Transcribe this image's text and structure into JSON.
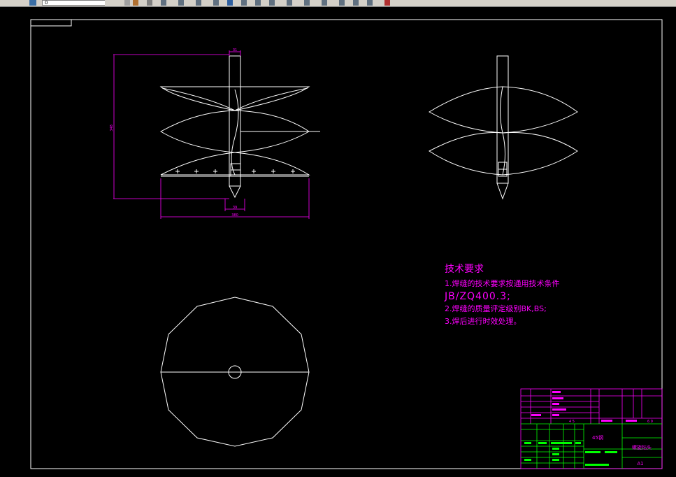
{
  "app": {
    "toolbar": {
      "layer_value": "0",
      "icons": [
        "save-icon",
        "brush-icon",
        "undo-icon",
        "layer-icon",
        "properties-icon",
        "copy-icon",
        "mirror-icon",
        "offset-icon",
        "array-icon",
        "move-icon",
        "rotate-icon",
        "scale-icon",
        "stretch-icon",
        "trim-icon",
        "extend-icon",
        "break-icon",
        "chamfer-icon",
        "fillet-icon",
        "explode-icon"
      ]
    }
  },
  "drawing": {
    "dimensions": {
      "shaft_width_top": "31",
      "height_left": "348",
      "tip_width_bottom": "39",
      "overall_width": "380"
    },
    "notes": {
      "title": "技术要求",
      "lines": [
        "1.焊缝的技术要求按通用技术条件",
        "JB/ZQ400.3;",
        "2.焊缝的质量评定级别BK,BS;",
        "3.焊后进行时效处理。"
      ]
    },
    "title_block": {
      "material": "45钢",
      "part_name": "螺旋钻头",
      "sheet_size": "A1",
      "scale": "4  5",
      "sheet": "6 9"
    },
    "colors": {
      "frame": "#ffffff",
      "geometry": "#ffffff",
      "dimension": "#ff00ff",
      "text": "#ff00ff",
      "title_block_lines": "#00ff00",
      "title_block_fill": "#00ff00"
    }
  }
}
